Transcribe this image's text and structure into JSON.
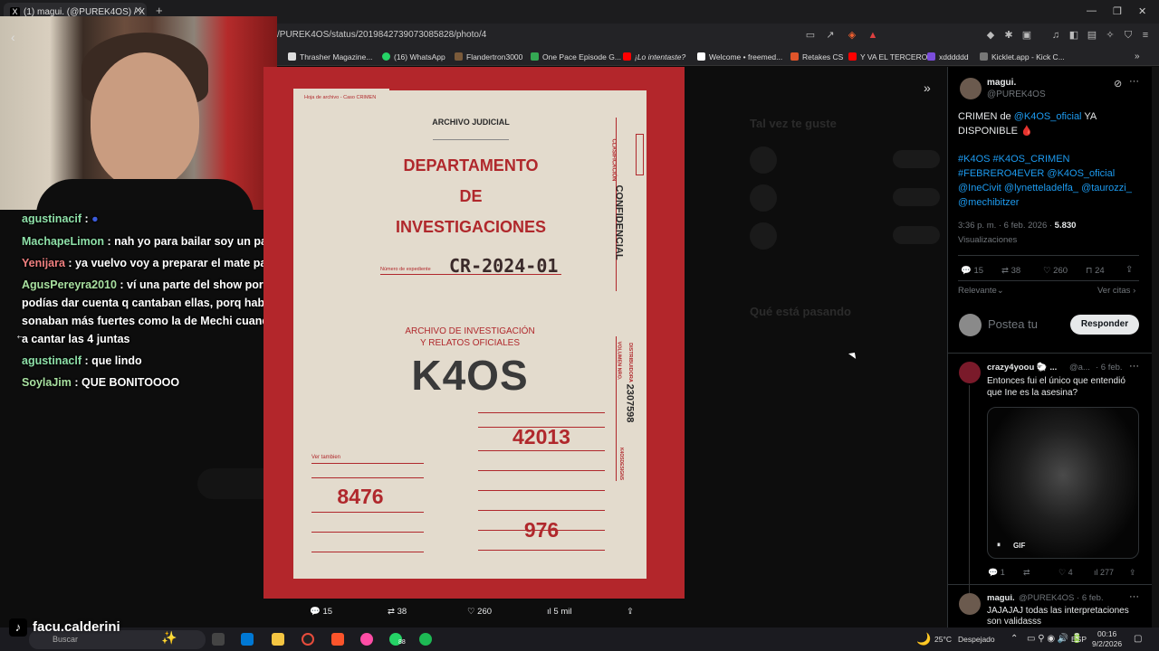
{
  "browser": {
    "tab_title": "(1) magui. (@PUREK4OS) / X",
    "url": "/PUREK4OS/status/2019842739073085828/photo/4",
    "bookmarks": [
      "Thrasher Magazine...",
      "(16) WhatsApp",
      "Flandertron3000",
      "One Pace Episode G...",
      "¡Lo intentaste?",
      "Welcome • freemed...",
      "Retakes CS",
      "Y VA EL TERCERO",
      "xdddddd",
      "Kicklet.app - Kick C..."
    ]
  },
  "chat": [
    {
      "user": "agustinacif",
      "msg": "",
      "color": "#8ee0a8"
    },
    {
      "user": "MachapeLimon",
      "msg": " : nah yo para bailar soy un palo😔",
      "color": "#8ee0a8"
    },
    {
      "user": "Yenijara",
      "msg": " : ya vuelvo voy a preparar el mate pausate xd",
      "color": "#f08080"
    },
    {
      "user": "AgusPereyra2010",
      "msg": " : ví una parte del show por tik tok y te podías dar cuenta q cantaban ellas, porq había voces sonaban más fuertes como la de Mechi cuando se ponían a cantar las 4 juntas",
      "color": "#a8e0a0"
    },
    {
      "user": "agustinaclf",
      "msg": " : que lindo",
      "color": "#8ee0a8"
    },
    {
      "user": "SoylaJim",
      "msg": " : QUE BONITOOOO",
      "color": "#a8e0a0"
    }
  ],
  "folder": {
    "small_label": "Hoja de archivo - Caso CRIMEN",
    "header": "ARCHIVO JUDICIAL",
    "dept1": "DEPARTAMENTO",
    "dept2": "DE",
    "dept3": "INVESTIGACIONES",
    "exp_label": "Número de expediente",
    "exp_number": "CR-2024-01",
    "clasificacion": "CLASIFICACIÓN",
    "confidencial": "CONFIDENCIAL",
    "archive1": "ARCHIVO DE INVESTIGACIÓN",
    "archive2": "Y RELATOS OFICIALES",
    "k4os": "K4OS",
    "volumen": "VOLUMEN NRO.",
    "vol_number": "2307598",
    "distribuidora": "DISTRIBUIDORA",
    "designs": "K4OSDESIGNS",
    "ver_tambien": "Ver tambien",
    "n1": "42013",
    "n2": "8476",
    "n3": "976"
  },
  "photo_actions": {
    "replies": "15",
    "reposts": "38",
    "likes": "260",
    "views": "5 mil"
  },
  "bg_page": {
    "may_like": "Tal vez te guste",
    "happening": "Qué está pasando"
  },
  "tweet": {
    "author": "magui.",
    "handle": "@PUREK4OS",
    "text1": "CRIMEN de ",
    "mention1": "@K4OS_oficial",
    "text2": " YA DISPONIBLE 🩸",
    "tags": "#K4OS #K4OS_CRIMEN #FEBRERO4EVER @K4OS_oficial @IneCivit @lynetteladelfa_ @taurozzi_ @mechibitzer",
    "time": "3:36 p. m. · 6 feb. 2026 · ",
    "views_num": "5.830",
    "views_label": "Visualizaciones",
    "replies": "15",
    "reposts": "38",
    "likes": "260",
    "bookmarks": "24",
    "sort": "Relevante",
    "quotes": "Ver citas",
    "reply_placeholder": "Postea tu",
    "reply_button": "Responder"
  },
  "reply1": {
    "author": "crazy4yoou 🐑 ...",
    "handle": "@a...",
    "date": "· 6 feb.",
    "text": "Entonces fui el único que entendió que Ine es la asesina?",
    "gif": "GIF",
    "replies": "1",
    "likes": "4",
    "views": "277"
  },
  "reply2": {
    "author": "magui.",
    "handle": "@PUREK4OS · 6 feb.",
    "text": "JAJAJAJ todas las interpretaciones son validasss"
  },
  "taskbar": {
    "streamer": "facu.calderini",
    "search": "Buscar",
    "weather": "25°C",
    "weather_desc": "Despejado",
    "lang": "ESP",
    "time": "00:16",
    "date": "9/2/2026",
    "badge": "88"
  }
}
